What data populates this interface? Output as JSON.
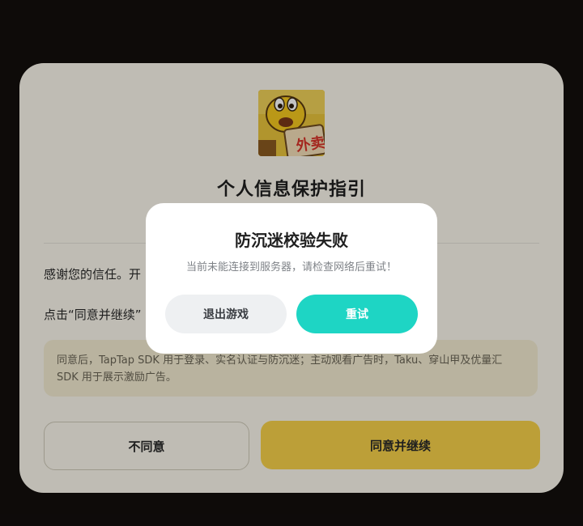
{
  "privacy_guide": {
    "title": "个人信息保护指引",
    "line1_start": "感谢您的信任。开",
    "line1_end": "。",
    "line2_start": "点击“同意并继续”",
    "sdk_note": "同意后，TapTap SDK 用于登录、实名认证与防沉迷；主动观看广告时，Taku、穿山甲及优量汇 SDK 用于展示激励广告。",
    "disagree_label": "不同意",
    "agree_label": "同意并继续",
    "app_icon_sign_text": "外卖"
  },
  "error_dialog": {
    "title": "防沉迷校验失败",
    "message": "当前未能连接到服务器，请检查网络后重试！",
    "exit_label": "退出游戏",
    "retry_label": "重试"
  },
  "colors": {
    "background": "#130f0d",
    "card": "#fbf8ed",
    "agree_button": "#f7d24a",
    "retry_button": "#1ed5c4",
    "exit_button": "#eef0f2"
  }
}
